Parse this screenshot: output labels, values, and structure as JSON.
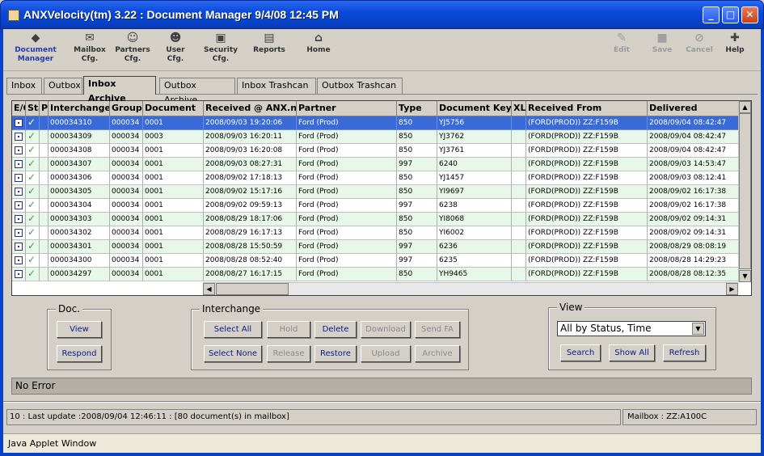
{
  "window": {
    "title": "ANXVelocity(tm) 3.22 : Document Manager 9/4/08 12:45 PM",
    "min": "_",
    "max": "□",
    "close": "✕"
  },
  "toolbar": {
    "left": [
      {
        "name": "document-manager",
        "line1": "Document",
        "line2": "Manager",
        "icon": "◆"
      },
      {
        "name": "mailbox-cfg",
        "line1": "Mailbox",
        "line2": "Cfg.",
        "icon": "✉"
      },
      {
        "name": "partners-cfg",
        "line1": "Partners",
        "line2": "Cfg.",
        "icon": "☺"
      },
      {
        "name": "user-cfg",
        "line1": "User",
        "line2": "Cfg.",
        "icon": "☻"
      },
      {
        "name": "security-cfg",
        "line1": "Security",
        "line2": "Cfg.",
        "icon": "▣"
      },
      {
        "name": "reports",
        "line1": "Reports",
        "line2": "",
        "icon": "▤"
      },
      {
        "name": "home",
        "line1": "Home",
        "line2": "",
        "icon": "⌂"
      }
    ],
    "right": [
      {
        "name": "edit",
        "label": "Edit",
        "icon": "✎"
      },
      {
        "name": "save",
        "label": "Save",
        "icon": "■"
      },
      {
        "name": "cancel",
        "label": "Cancel",
        "icon": "⊘"
      },
      {
        "name": "help",
        "label": "Help",
        "icon": "✚"
      }
    ]
  },
  "tabs": [
    "Inbox",
    "Outbox",
    "Inbox Archive",
    "Outbox Archive",
    "Inbox Trashcan",
    "Outbox Trashcan"
  ],
  "grid": {
    "headers": [
      "E/O",
      "Sta",
      "P",
      "Interchange",
      "Group",
      "Document",
      "Received @ ANX.net",
      "Partner",
      "Type",
      "Document Key",
      "XLate",
      "Received From",
      "Delivered"
    ],
    "rows": [
      {
        "interchange": "000034310",
        "group": "000034",
        "document": "0001",
        "received": "2008/09/03 19:20:06",
        "partner": "Ford (Prod)",
        "type": "850",
        "key": "YJ5756",
        "from": "(FORD(PROD)) ZZ:F159B",
        "delivered": "2008/09/04 08:42:47"
      },
      {
        "interchange": "000034309",
        "group": "000034",
        "document": "0003",
        "received": "2008/09/03 16:20:11",
        "partner": "Ford (Prod)",
        "type": "850",
        "key": "YJ3762",
        "from": "(FORD(PROD)) ZZ:F159B",
        "delivered": "2008/09/04 08:42:47"
      },
      {
        "interchange": "000034308",
        "group": "000034",
        "document": "0001",
        "received": "2008/09/03 16:20:08",
        "partner": "Ford (Prod)",
        "type": "850",
        "key": "YJ3761",
        "from": "(FORD(PROD)) ZZ:F159B",
        "delivered": "2008/09/04 08:42:47"
      },
      {
        "interchange": "000034307",
        "group": "000034",
        "document": "0001",
        "received": "2008/09/03 08:27:31",
        "partner": "Ford (Prod)",
        "type": "997",
        "key": "6240",
        "from": "(FORD(PROD)) ZZ:F159B",
        "delivered": "2008/09/03 14:53:47"
      },
      {
        "interchange": "000034306",
        "group": "000034",
        "document": "0001",
        "received": "2008/09/02 17:18:13",
        "partner": "Ford (Prod)",
        "type": "850",
        "key": "YJ1457",
        "from": "(FORD(PROD)) ZZ:F159B",
        "delivered": "2008/09/03 08:12:41"
      },
      {
        "interchange": "000034305",
        "group": "000034",
        "document": "0001",
        "received": "2008/09/02 15:17:16",
        "partner": "Ford (Prod)",
        "type": "850",
        "key": "YI9697",
        "from": "(FORD(PROD)) ZZ:F159B",
        "delivered": "2008/09/02 16:17:38"
      },
      {
        "interchange": "000034304",
        "group": "000034",
        "document": "0001",
        "received": "2008/09/02 09:59:13",
        "partner": "Ford (Prod)",
        "type": "997",
        "key": "6238",
        "from": "(FORD(PROD)) ZZ:F159B",
        "delivered": "2008/09/02 16:17:38"
      },
      {
        "interchange": "000034303",
        "group": "000034",
        "document": "0001",
        "received": "2008/08/29 18:17:06",
        "partner": "Ford (Prod)",
        "type": "850",
        "key": "YI8068",
        "from": "(FORD(PROD)) ZZ:F159B",
        "delivered": "2008/09/02 09:14:31"
      },
      {
        "interchange": "000034302",
        "group": "000034",
        "document": "0001",
        "received": "2008/08/29 16:17:13",
        "partner": "Ford (Prod)",
        "type": "850",
        "key": "YI6002",
        "from": "(FORD(PROD)) ZZ:F159B",
        "delivered": "2008/09/02 09:14:31"
      },
      {
        "interchange": "000034301",
        "group": "000034",
        "document": "0001",
        "received": "2008/08/28 15:50:59",
        "partner": "Ford (Prod)",
        "type": "997",
        "key": "6236",
        "from": "(FORD(PROD)) ZZ:F159B",
        "delivered": "2008/08/29 08:08:19"
      },
      {
        "interchange": "000034300",
        "group": "000034",
        "document": "0001",
        "received": "2008/08/28 08:52:40",
        "partner": "Ford (Prod)",
        "type": "997",
        "key": "6235",
        "from": "(FORD(PROD)) ZZ:F159B",
        "delivered": "2008/08/28 14:29:23"
      },
      {
        "interchange": "000034297",
        "group": "000034",
        "document": "0001",
        "received": "2008/08/27 16:17:15",
        "partner": "Ford (Prod)",
        "type": "850",
        "key": "YH9465",
        "from": "(FORD(PROD)) ZZ:F159B",
        "delivered": "2008/08/28 08:12:35"
      }
    ]
  },
  "doc": {
    "label": "Doc.",
    "view": "View",
    "respond": "Respond"
  },
  "interchange": {
    "label": "Interchange",
    "select_all": "Select All",
    "hold": "Hold",
    "delete": "Delete",
    "download": "Download",
    "send_fa": "Send FA",
    "select_none": "Select None",
    "release": "Release",
    "restore": "Restore",
    "upload": "Upload",
    "archive": "Archive"
  },
  "view": {
    "label": "View",
    "selected": "All by Status, Time",
    "search": "Search",
    "show_all": "Show All",
    "refresh": "Refresh"
  },
  "status": {
    "message": "No Error",
    "update": "10 : Last update :2008/09/04 12:46:11 : [80 document(s) in mailbox]",
    "mailbox": "Mailbox : ZZ:A100C"
  },
  "applet": "Java Applet Window",
  "colors": {
    "title_blue": "#0a4ad8",
    "selected_row": "#3a6ad8",
    "alt_row": "#e8f8e8",
    "button_text": "#0a1a88"
  }
}
